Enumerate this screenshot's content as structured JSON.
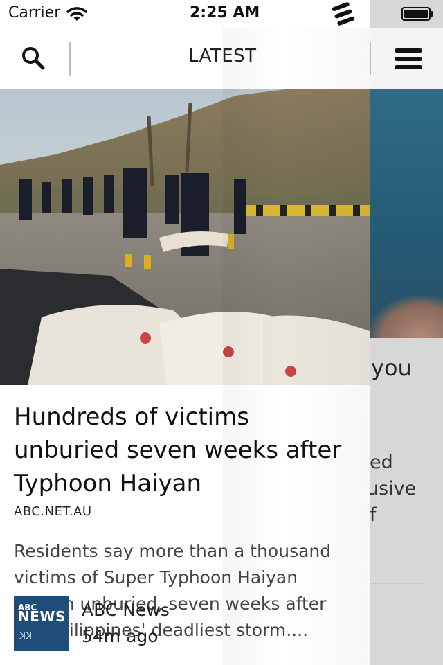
{
  "status_bar": {
    "carrier": "Carrier",
    "time": "2:25 AM"
  },
  "nav": {
    "title": "LATEST",
    "search_icon": "search-icon",
    "menu_icon": "hamburger-menu-icon"
  },
  "article": {
    "headline": "Hundreds of victims unburied seven weeks after Typhoon Haiyan",
    "source": "ABC.NET.AU",
    "summary": "Residents say more than a thousand victims of Super Typhoon Haiyan remain unburied, seven weeks after the Philippines' deadliest storm....",
    "publisher": {
      "logo_top": "ABC",
      "logo_main": "NEWS",
      "logo_mark": "ꓘꓘ",
      "name": "ABC News",
      "time_ago": "54m ago"
    }
  },
  "next_card": {
    "title_fragment": "you",
    "lines": [
      "ed",
      "usive",
      "f"
    ]
  },
  "colors": {
    "accent": "#1f4c78",
    "text": "#111111",
    "muted": "#444444"
  }
}
